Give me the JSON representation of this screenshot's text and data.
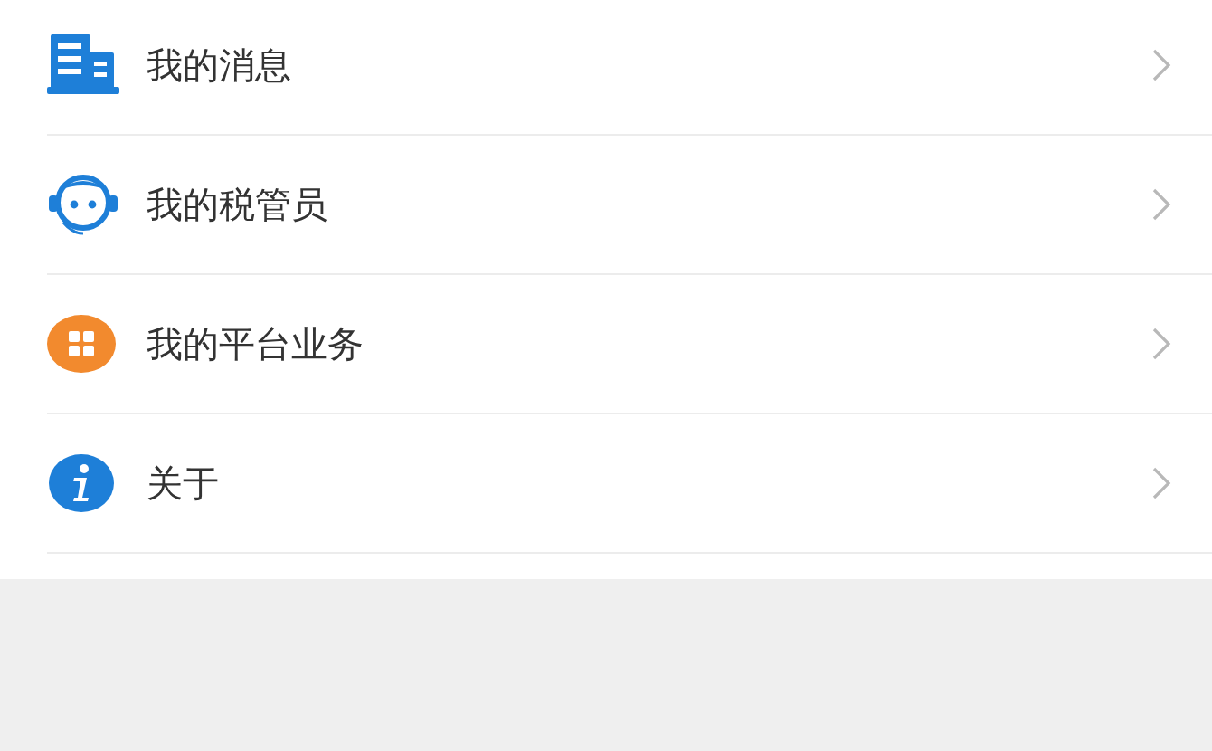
{
  "menu": {
    "items": [
      {
        "label": "我的消息"
      },
      {
        "label": "我的税管员"
      },
      {
        "label": "我的平台业务"
      },
      {
        "label": "关于"
      }
    ]
  }
}
